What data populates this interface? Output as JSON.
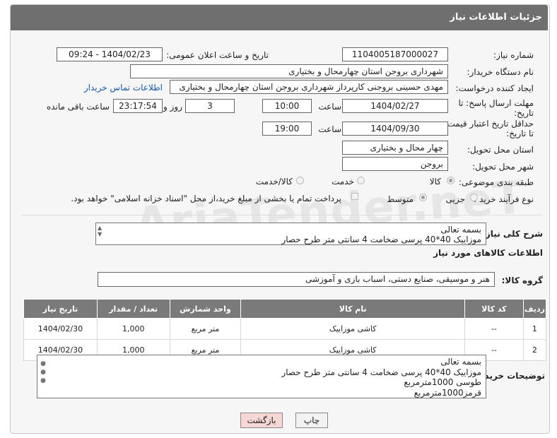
{
  "header": {
    "title": "جزئیات اطلاعات نیاز"
  },
  "need_number": {
    "label": "شماره نیاز:",
    "value": "1104005187000027"
  },
  "announce": {
    "label": "تاریخ و ساعت اعلان عمومی:",
    "value": "1404/02/23 - 09:24"
  },
  "buyer_org": {
    "label": "نام دستگاه خریدار:",
    "value": "شهرداری بروجن استان چهارمحال و بختیاری"
  },
  "requester": {
    "label": "ایجاد کننده درخواست:",
    "value": "مهدی حسینی بروجنی کارپرداز شهرداری بروجن استان چهارمحال و بختیاری",
    "contact_link": "اطلاعات تماس خریدار"
  },
  "reply_deadline": {
    "label": "مهلت ارسال پاسخ: تا تاریخ:",
    "date": "1404/02/27",
    "time_label": "ساعت",
    "time": "10:00",
    "days": "3",
    "days_label": "روز و",
    "remaining": "23:17:54",
    "remaining_label": "ساعت باقی مانده"
  },
  "price_validity": {
    "label": "حداقل تاریخ اعتبار قیمت: تا تاریخ:",
    "date": "1404/09/30",
    "time_label": "ساعت",
    "time": "19:00"
  },
  "province": {
    "label": "استان محل تحویل:",
    "value": "چهار محال و بختیاری"
  },
  "city": {
    "label": "شهر محل تحویل:",
    "value": "بروجن"
  },
  "category": {
    "label": "طبقه بندی موضوعی:",
    "options": [
      "کالا",
      "خدمت",
      "کالا/خدمت"
    ],
    "selected": "کالا"
  },
  "process": {
    "label": "نوع فرآیند خرید :",
    "options": [
      "جزیی",
      "متوسط"
    ],
    "selected": "متوسط",
    "payment_note": "پرداخت تمام یا بخشی از مبلغ خرید،از محل \"اسناد خزانه اسلامی\" خواهد بود."
  },
  "description": {
    "label": "شرح کلی نیاز:",
    "lines": [
      "بسمه تعالی",
      "موزاییک 40*40 پرسی ضخامت 4 سانتی متر طرح حصار"
    ]
  },
  "goods_section": {
    "title": "اطلاعات کالاهای مورد نیاز"
  },
  "goods_group": {
    "label": "گروه کالا:",
    "value": "هنر و موسیقی، صنایع دستی، اسباب بازی و آموزشی"
  },
  "table": {
    "headers": [
      "ردیف",
      "کد کالا",
      "نام کالا",
      "واحد شمارش",
      "تعداد / مقدار",
      "تاریخ نیاز"
    ],
    "rows": [
      [
        "1",
        "--",
        "کاشی موزاییک",
        "متر مربع",
        "1,000",
        "1404/02/30"
      ],
      [
        "2",
        "--",
        "کاشی موزاییک",
        "متر مربع",
        "1,000",
        "1404/02/30"
      ]
    ]
  },
  "buyer_notes": {
    "label": "توضیحات خریدار:",
    "lines": [
      "بسمه تعالی",
      "موزاییک 40*40 پرسی ضخامت 4 سانتی متر طرح حصار",
      "طوسی 1000مترمربع",
      "قرمز1000مترمربع"
    ]
  },
  "buttons": {
    "print": "چاپ",
    "back": "بازگشت"
  },
  "watermark": "AriaTender.neT",
  "colors": {
    "header_bg": "#6f6f6f",
    "link": "#1a55a8",
    "back_btn_bg": "#f7d6d6"
  }
}
